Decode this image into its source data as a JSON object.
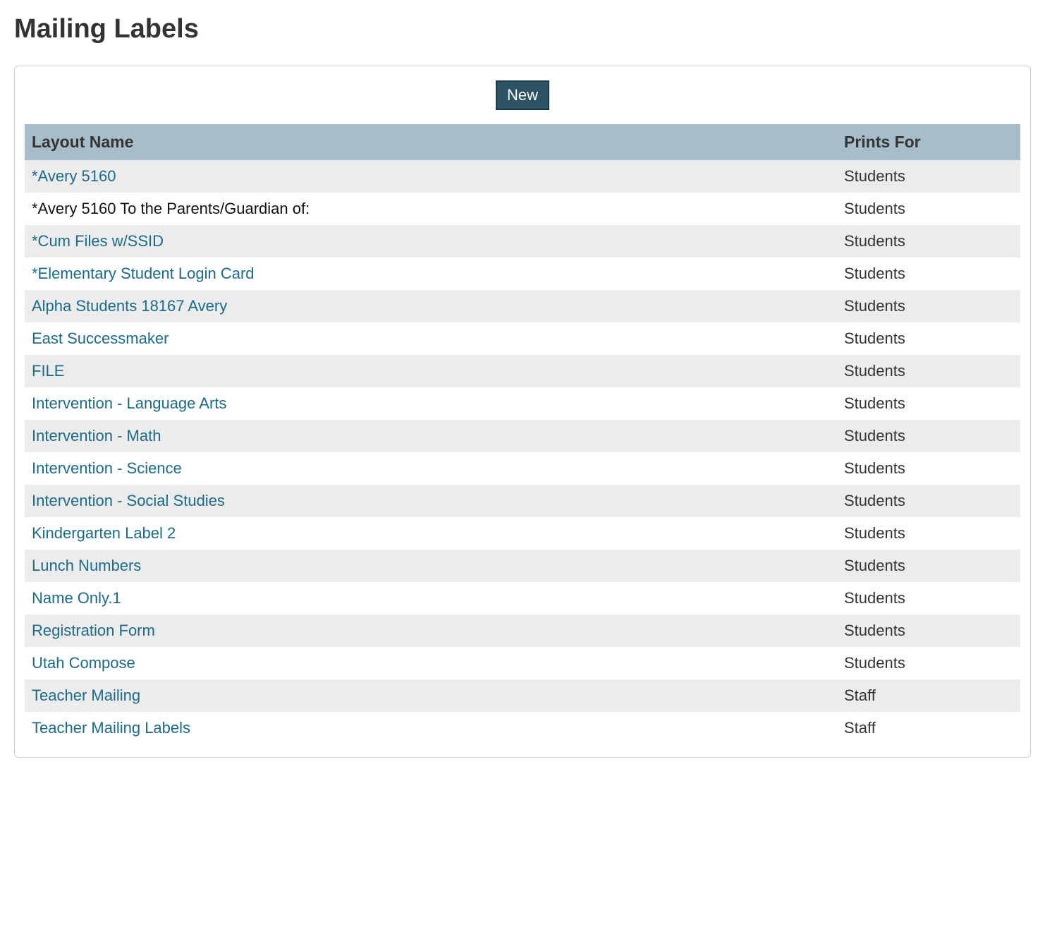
{
  "title": "Mailing Labels",
  "new_button_label": "New",
  "columns": {
    "layout_name": "Layout Name",
    "prints_for": "Prints For"
  },
  "rows": [
    {
      "name": "*Avery 5160",
      "prints_for": "Students",
      "link": true
    },
    {
      "name": "*Avery 5160 To the Parents/Guardian of:",
      "prints_for": "Students",
      "link": false
    },
    {
      "name": "*Cum Files w/SSID",
      "prints_for": "Students",
      "link": true
    },
    {
      "name": "*Elementary Student Login Card",
      "prints_for": "Students",
      "link": true
    },
    {
      "name": "Alpha Students 18167 Avery",
      "prints_for": "Students",
      "link": true
    },
    {
      "name": "East Successmaker",
      "prints_for": "Students",
      "link": true
    },
    {
      "name": "FILE",
      "prints_for": "Students",
      "link": true
    },
    {
      "name": "Intervention - Language Arts",
      "prints_for": "Students",
      "link": true
    },
    {
      "name": "Intervention - Math",
      "prints_for": "Students",
      "link": true
    },
    {
      "name": "Intervention - Science",
      "prints_for": "Students",
      "link": true
    },
    {
      "name": "Intervention - Social Studies",
      "prints_for": "Students",
      "link": true
    },
    {
      "name": "Kindergarten Label 2",
      "prints_for": "Students",
      "link": true
    },
    {
      "name": "Lunch Numbers",
      "prints_for": "Students",
      "link": true
    },
    {
      "name": "Name Only.1",
      "prints_for": "Students",
      "link": true
    },
    {
      "name": "Registration Form",
      "prints_for": "Students",
      "link": true
    },
    {
      "name": "Utah Compose",
      "prints_for": "Students",
      "link": true
    },
    {
      "name": "Teacher Mailing",
      "prints_for": "Staff",
      "link": true
    },
    {
      "name": "Teacher Mailing Labels",
      "prints_for": "Staff",
      "link": true
    }
  ]
}
